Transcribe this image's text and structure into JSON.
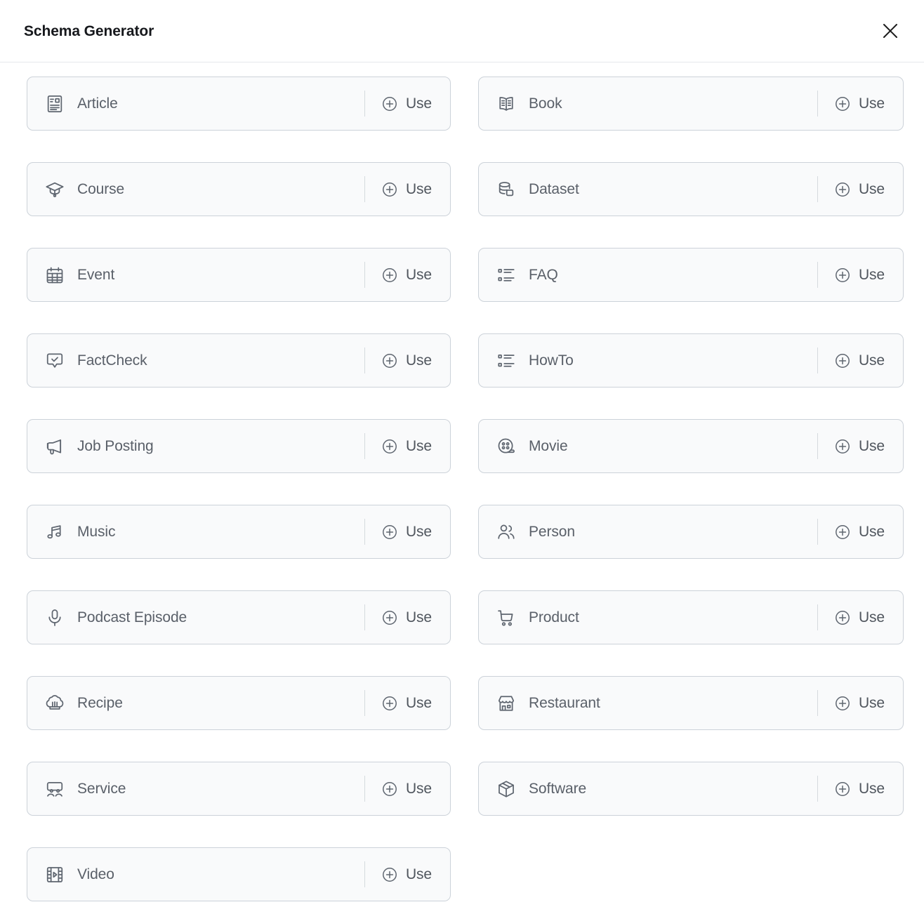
{
  "header": {
    "title": "Schema Generator",
    "close_icon": "close-icon"
  },
  "grid": {
    "use_label": "Use",
    "plus_icon": "plus-circle-icon",
    "cards": [
      {
        "label": "Article",
        "icon": "article-icon"
      },
      {
        "label": "Book",
        "icon": "book-icon"
      },
      {
        "label": "Course",
        "icon": "graduation-cap-icon"
      },
      {
        "label": "Dataset",
        "icon": "database-icon"
      },
      {
        "label": "Event",
        "icon": "calendar-icon"
      },
      {
        "label": "FAQ",
        "icon": "list-icon"
      },
      {
        "label": "FactCheck",
        "icon": "speech-bubble-check-icon"
      },
      {
        "label": "HowTo",
        "icon": "list-icon"
      },
      {
        "label": "Job Posting",
        "icon": "megaphone-icon"
      },
      {
        "label": "Movie",
        "icon": "film-reel-icon"
      },
      {
        "label": "Music",
        "icon": "music-note-icon"
      },
      {
        "label": "Person",
        "icon": "people-icon"
      },
      {
        "label": "Podcast Episode",
        "icon": "microphone-icon"
      },
      {
        "label": "Product",
        "icon": "shopping-cart-icon"
      },
      {
        "label": "Recipe",
        "icon": "chef-hat-icon"
      },
      {
        "label": "Restaurant",
        "icon": "storefront-icon"
      },
      {
        "label": "Service",
        "icon": "service-counter-icon"
      },
      {
        "label": "Software",
        "icon": "package-box-icon"
      },
      {
        "label": "Video",
        "icon": "film-strip-play-icon"
      }
    ]
  },
  "colors": {
    "card_background": "#f9fafb",
    "card_border": "#ccd2d9",
    "label_text": "#5a6069",
    "title_text": "#16181c",
    "icon_stroke": "#5f6670"
  }
}
